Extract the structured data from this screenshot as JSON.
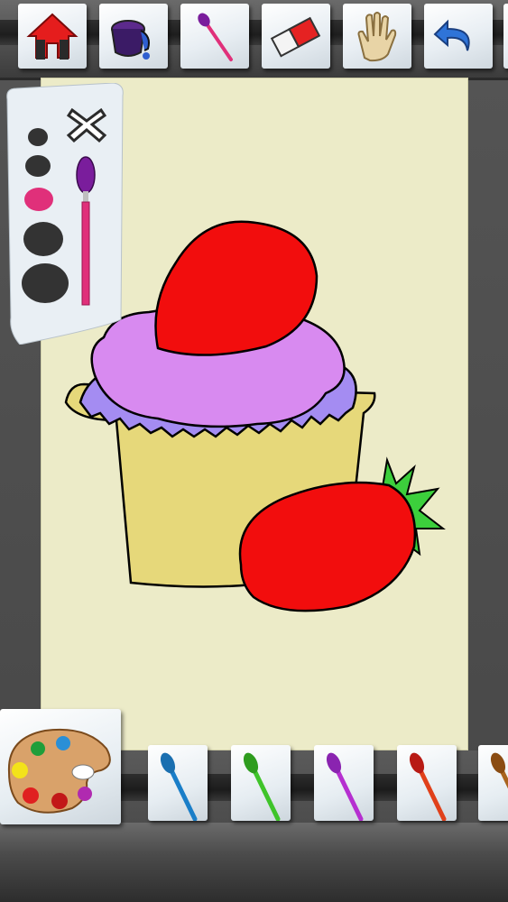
{
  "toolbar": {
    "tools": [
      {
        "name": "home-icon"
      },
      {
        "name": "paint-bucket-icon"
      },
      {
        "name": "brush-tool-icon"
      },
      {
        "name": "eraser-icon"
      },
      {
        "name": "hand-pan-icon"
      },
      {
        "name": "undo-icon"
      }
    ]
  },
  "size_panel": {
    "close_icon": "close-icon",
    "selected_color": "#e0307a",
    "sizes": [
      "xs",
      "s",
      "m",
      "l",
      "xl"
    ],
    "selected_size": "m"
  },
  "canvas": {
    "background": "#ecebc8",
    "drawing": "cupcake-with-strawberries",
    "colors": {
      "frosting_top": "#d88af0",
      "frosting_bottom": "#a48cf2",
      "cup": "#e6d87a",
      "strawberry": "#f20d0d",
      "leaves": "#3ccf3c"
    }
  },
  "palette": {
    "icon": "paint-palette-icon",
    "paint_colors": [
      "#1f9e3a",
      "#2a8fd6",
      "#f3e21a",
      "#e02020",
      "#c21818",
      "#b02ab0",
      "#ffffff"
    ]
  },
  "brushes": [
    {
      "name": "brush-teal",
      "color": "#1a7ec8"
    },
    {
      "name": "brush-green",
      "color": "#3fc42a"
    },
    {
      "name": "brush-purple",
      "color": "#9b2fd0"
    },
    {
      "name": "brush-red",
      "color": "#d8201a"
    },
    {
      "name": "brush-brown",
      "color": "#a8641e"
    }
  ]
}
